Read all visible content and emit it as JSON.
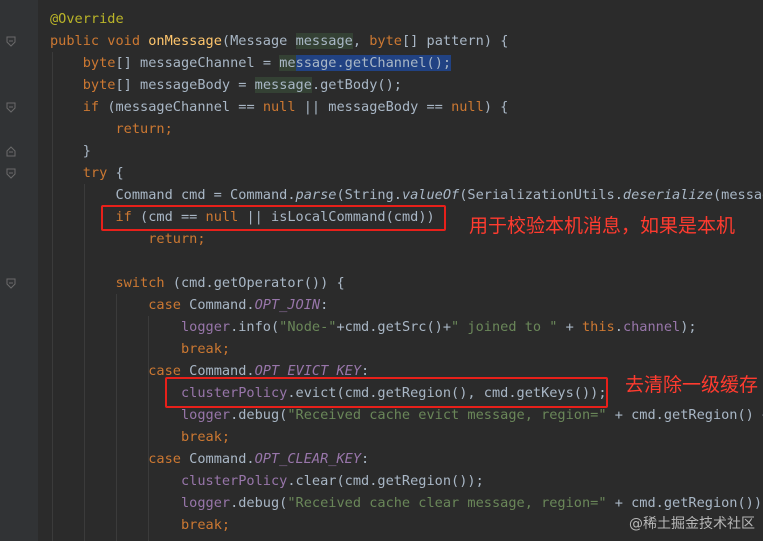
{
  "lines": [
    [
      {
        "t": "@Override",
        "c": "an"
      }
    ],
    [
      {
        "t": "public void ",
        "c": "kw"
      },
      {
        "t": "onMessage",
        "c": "fn"
      },
      {
        "t": "(Message "
      },
      {
        "t": "message",
        "c": "hl2"
      },
      {
        "t": ", "
      },
      {
        "t": "byte",
        "c": "kw"
      },
      {
        "t": "[] pattern) {"
      }
    ],
    [
      {
        "t": "    "
      },
      {
        "t": "byte",
        "c": "kw"
      },
      {
        "t": "[] messageChannel = "
      },
      {
        "t": "me",
        "c": "hl2"
      },
      {
        "t": "ssage.getChannel();",
        "c": "hl"
      }
    ],
    [
      {
        "t": "    "
      },
      {
        "t": "byte",
        "c": "kw"
      },
      {
        "t": "[] messageBody = "
      },
      {
        "t": "message",
        "c": "hl2"
      },
      {
        "t": ".getBody();"
      }
    ],
    [
      {
        "t": "    "
      },
      {
        "t": "if ",
        "c": "kw"
      },
      {
        "t": "(messageChannel == "
      },
      {
        "t": "null ",
        "c": "kw"
      },
      {
        "t": "|| messageBody == "
      },
      {
        "t": "null",
        "c": "kw"
      },
      {
        "t": ") {"
      }
    ],
    [
      {
        "t": "        "
      },
      {
        "t": "return;",
        "c": "kw"
      }
    ],
    [
      {
        "t": "    }"
      }
    ],
    [
      {
        "t": "    "
      },
      {
        "t": "try ",
        "c": "kw"
      },
      {
        "t": "{"
      }
    ],
    [
      {
        "t": "        Command cmd = Command."
      },
      {
        "t": "parse",
        "c": "it"
      },
      {
        "t": "(String."
      },
      {
        "t": "valueOf",
        "c": "it"
      },
      {
        "t": "(SerializationUtils."
      },
      {
        "t": "deserialize",
        "c": "it"
      },
      {
        "t": "(message"
      }
    ],
    [
      {
        "t": "        "
      },
      {
        "t": "if ",
        "c": "kw"
      },
      {
        "t": "(cmd == "
      },
      {
        "t": "null ",
        "c": "kw"
      },
      {
        "t": "|| isLocalCommand(cmd))"
      }
    ],
    [
      {
        "t": "            "
      },
      {
        "t": "return;",
        "c": "kw"
      }
    ],
    [
      {
        "t": ""
      }
    ],
    [
      {
        "t": "        "
      },
      {
        "t": "switch ",
        "c": "kw"
      },
      {
        "t": "(cmd.getOperator()) {"
      }
    ],
    [
      {
        "t": "            "
      },
      {
        "t": "case ",
        "c": "kw"
      },
      {
        "t": "Command."
      },
      {
        "t": "OPT_JOIN",
        "c": "cn"
      },
      {
        "t": ":"
      }
    ],
    [
      {
        "t": "                "
      },
      {
        "t": "logger",
        "c": "fd"
      },
      {
        "t": ".info("
      },
      {
        "t": "\"Node-\"",
        "c": "st"
      },
      {
        "t": "+cmd.getSrc()+"
      },
      {
        "t": "\" joined to \" ",
        "c": "st"
      },
      {
        "t": "+ "
      },
      {
        "t": "this",
        "c": "kw"
      },
      {
        "t": "."
      },
      {
        "t": "channel",
        "c": "fd"
      },
      {
        "t": ");"
      }
    ],
    [
      {
        "t": "                "
      },
      {
        "t": "break;",
        "c": "kw"
      }
    ],
    [
      {
        "t": "            "
      },
      {
        "t": "case ",
        "c": "kw"
      },
      {
        "t": "Command."
      },
      {
        "t": "OPT_EVICT_KEY",
        "c": "cn"
      },
      {
        "t": ":"
      }
    ],
    [
      {
        "t": "                "
      },
      {
        "t": "clusterPolicy",
        "c": "fd"
      },
      {
        "t": ".evict(cmd.getRegion(), cmd.getKeys());"
      }
    ],
    [
      {
        "t": "                "
      },
      {
        "t": "logger",
        "c": "fd"
      },
      {
        "t": ".debug("
      },
      {
        "t": "\"Received cache evict message, region=\" ",
        "c": "st"
      },
      {
        "t": "+ cmd.getRegion() +"
      }
    ],
    [
      {
        "t": "                "
      },
      {
        "t": "break;",
        "c": "kw"
      }
    ],
    [
      {
        "t": "            "
      },
      {
        "t": "case ",
        "c": "kw"
      },
      {
        "t": "Command."
      },
      {
        "t": "OPT_CLEAR_KEY",
        "c": "cn"
      },
      {
        "t": ":"
      }
    ],
    [
      {
        "t": "                "
      },
      {
        "t": "clusterPolicy",
        "c": "fd"
      },
      {
        "t": ".clear(cmd.getRegion());"
      }
    ],
    [
      {
        "t": "                "
      },
      {
        "t": "logger",
        "c": "fd"
      },
      {
        "t": ".debug("
      },
      {
        "t": "\"Received cache clear message, region=\" ",
        "c": "st"
      },
      {
        "t": "+ cmd.getRegion());"
      }
    ],
    [
      {
        "t": "                "
      },
      {
        "t": "break;",
        "c": "kw"
      }
    ]
  ],
  "annotations": {
    "note1": "用于校验本机消息，如果是本机",
    "note2": "去清除一级缓存"
  },
  "watermark": "@稀土掘金技术社区",
  "colors": {
    "background": "#2b2b2b",
    "keyword": "#cc7832",
    "method": "#ffc66d",
    "annotation": "#bbb529",
    "string": "#6a8759",
    "field": "#9876aa",
    "highlight_box": "#e8201a"
  }
}
